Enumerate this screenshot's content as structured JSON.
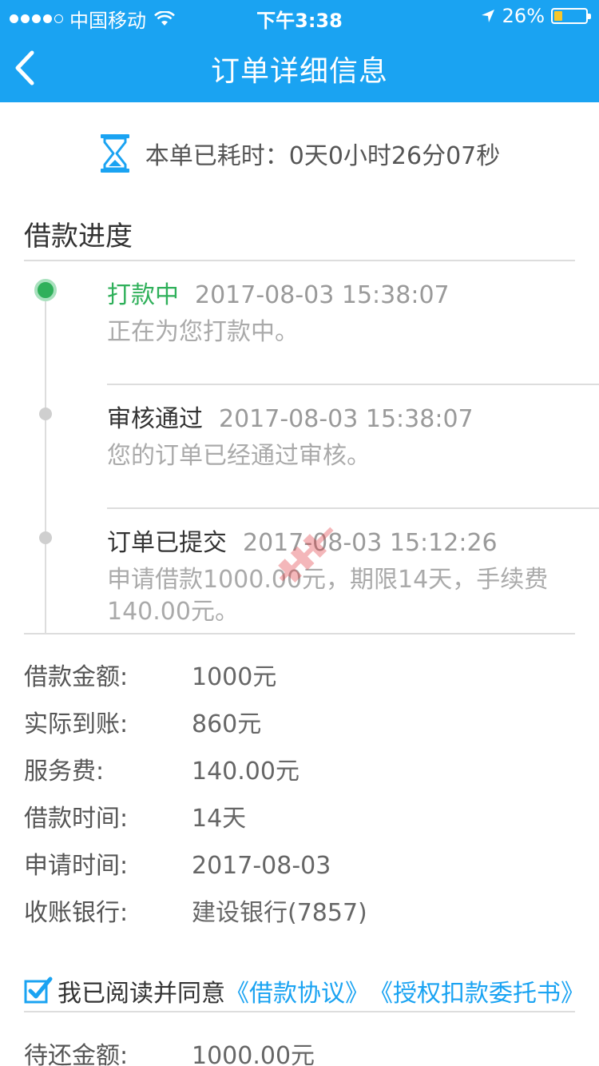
{
  "status_bar": {
    "carrier": "中国移动",
    "time": "下午3:38",
    "battery": "26%",
    "battery_level": 0.26
  },
  "nav": {
    "title": "订单详细信息",
    "back_icon": "chevron-left-icon"
  },
  "elapsed": {
    "icon": "hourglass-icon",
    "text": "本单已耗时：0天0小时26分07秒"
  },
  "progress": {
    "title": "借款进度",
    "steps": [
      {
        "status": "打款中",
        "time": "2017-08-03 15:38:07",
        "desc": "正在为您打款中。",
        "active": true
      },
      {
        "status": "审核通过",
        "time": "2017-08-03 15:38:07",
        "desc": "您的订单已经通过审核。",
        "active": false
      },
      {
        "status": "订单已提交",
        "time": "2017-08-03 15:12:26",
        "desc": "申请借款1000.00元，期限14天，手续费140.00元。",
        "active": false
      }
    ]
  },
  "details": [
    {
      "label": "借款金额:",
      "value": "1000元"
    },
    {
      "label": "实际到账:",
      "value": "860元"
    },
    {
      "label": "服务费:",
      "value": "140.00元"
    },
    {
      "label": "借款时间:",
      "value": "14天"
    },
    {
      "label": "申请时间:",
      "value": "2017-08-03"
    },
    {
      "label": "收账银行:",
      "value": "建设银行(7857)"
    }
  ],
  "agreement": {
    "checked": true,
    "text": "我已阅读并同意",
    "link1": "《借款协议》",
    "link2": "《授权扣款委托书》"
  },
  "due": {
    "label": "待还金额:",
    "value": "1000.00元"
  },
  "colors": {
    "brand": "#1aa3f2",
    "active": "#2fb05a",
    "watermark": "#e0353b"
  }
}
